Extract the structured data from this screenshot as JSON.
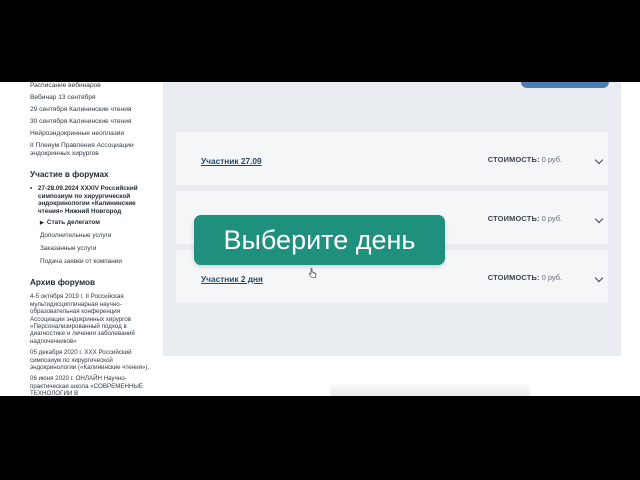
{
  "sidebar": {
    "links": [
      "Расписание вебинаров",
      "Вебинар 13 сентября",
      "29 сентября Калининские чтения",
      "30 сентября Калининские чтения",
      "Нейроэндокринные неоплазии",
      "II Пленум Правления Ассоциации эндокринных хирургов"
    ],
    "forums_heading": "Участие в форумах",
    "forum_item": "27-28.09.2024 XXXIV Российский симпозиум по хирургической эндокринологии «Калининские чтения» Нижний Новгород",
    "sub_items": [
      "Стать делегатом",
      "Дополнительные услуги",
      "Заказанные услуги",
      "Подача заявки от компании"
    ],
    "archive_heading": "Архив форумов",
    "archive_items": [
      "4-5 октября 2019 г. II Российская мультидисциплинарная научно-образовательная конференция Ассоциации эндокринных хирургов «Персонализированный подход в диагностике и лечении заболеваний надпочечников»",
      "05 декабря 2020 г. XXX Российский симпозиум по хирургической эндокринологии («Калининские чтения»).",
      "06 июня 2020 г. ОНЛАЙН Научно-практическая школа «СОВРЕМЕННЫЕ ТЕХНОЛОГИИ В"
    ]
  },
  "main": {
    "price_label": "СТОИМОСТЬ:",
    "rows": [
      {
        "label": "Участник 27.09",
        "price": "0 руб."
      },
      {
        "label": "",
        "price": "0 руб."
      },
      {
        "label": "Участник 2 дня",
        "price": "0 руб."
      }
    ]
  },
  "overlay": {
    "caption": "Выберите день"
  },
  "colors": {
    "caption_bg": "#1f8f7e",
    "panel_bg": "#e9edf2",
    "link_color": "#274866",
    "accent_button": "#4a7fb5"
  }
}
